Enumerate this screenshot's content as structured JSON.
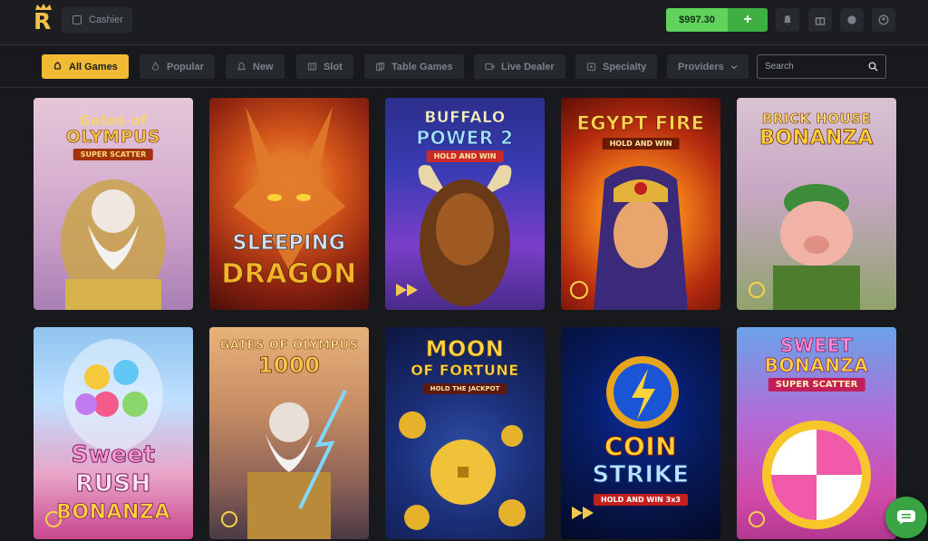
{
  "header": {
    "logo_letter": "R",
    "cashier_label": "Cashier",
    "balance": "$997.30",
    "deposit_label": "+",
    "icons": [
      "bell-icon",
      "gift-icon",
      "globe-icon",
      "user-icon"
    ]
  },
  "filters": {
    "items": [
      {
        "label": "All Games",
        "icon": "rocket-icon",
        "active": true
      },
      {
        "label": "Popular",
        "icon": "flame-icon",
        "active": false
      },
      {
        "label": "New",
        "icon": "bell-icon",
        "active": false
      },
      {
        "label": "Slot",
        "icon": "slot-icon",
        "active": false
      },
      {
        "label": "Table Games",
        "icon": "cards-icon",
        "active": false
      },
      {
        "label": "Live Dealer",
        "icon": "video-icon",
        "active": false
      },
      {
        "label": "Specialty",
        "icon": "puzzle-icon",
        "active": false
      },
      {
        "label": "Providers",
        "icon": "chevron-down-icon",
        "active": false
      }
    ],
    "search_placeholder": "Search"
  },
  "games": [
    {
      "line1": "Gates of",
      "line2": "OLYMPUS",
      "sub": "SUPER SCATTER"
    },
    {
      "line1": "SLEEPING",
      "line2": "DRAGON",
      "sub": ""
    },
    {
      "line1": "BUFFALO",
      "line2": "POWER 2",
      "sub": "HOLD AND WIN"
    },
    {
      "line1": "EGYPT FIRE",
      "line2": "",
      "sub": "HOLD AND WIN"
    },
    {
      "line1": "BRICK HOUSE",
      "line2": "BONANZA",
      "sub": ""
    },
    {
      "line1": "Sweet",
      "line2": "RUSH",
      "sub": "BONANZA"
    },
    {
      "line1": "GATES OF OLYMPUS",
      "line2": "1000",
      "sub": ""
    },
    {
      "line1": "MOON",
      "line2": "OF FORTUNE",
      "sub": "HOLD THE JACKPOT"
    },
    {
      "line1": "COIN",
      "line2": "STRIKE",
      "sub": "HOLD AND WIN 3x3"
    },
    {
      "line1": "SWEET",
      "line2": "BONANZA",
      "sub": "SUPER SCATTER"
    }
  ],
  "colors": {
    "accent": "#f1b934",
    "balance_green": "#5fd35b",
    "deposit_green": "#3fae43",
    "background": "#17191d"
  }
}
